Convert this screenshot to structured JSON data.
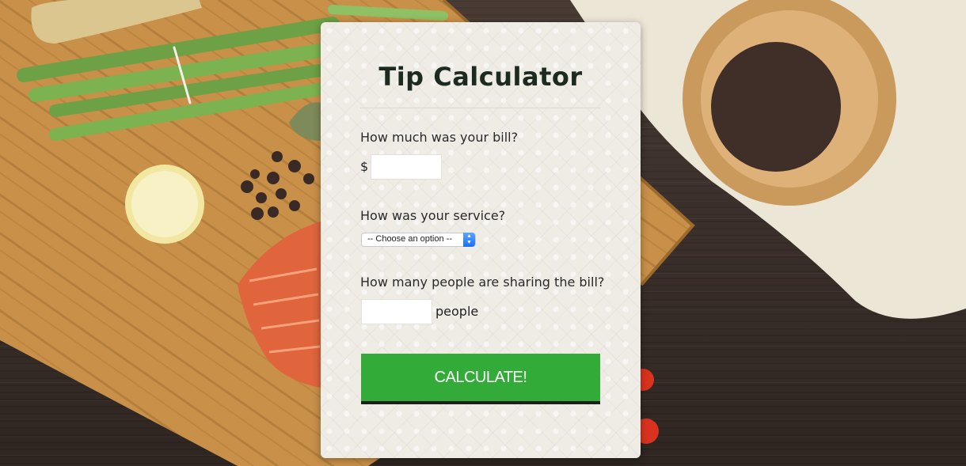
{
  "calculator": {
    "title": "Tip Calculator",
    "bill_label": "How much was your bill?",
    "currency_symbol": "$",
    "bill_value": "",
    "service_label": "How was your service?",
    "service_selected": "-- Choose an option --",
    "people_label": "How many people are sharing the bill?",
    "people_value": "",
    "people_suffix": "people",
    "calculate_label": "CALCULATE!"
  },
  "colors": {
    "button": "#33ab39",
    "card": "#efece6",
    "title": "#1d2a1f"
  },
  "background": {
    "description_icons": [
      "cutting-board",
      "asparagus",
      "lemon-slice",
      "salmon-fillet",
      "peppercorns",
      "wooden-bowl",
      "linen-cloth",
      "tomato"
    ]
  }
}
